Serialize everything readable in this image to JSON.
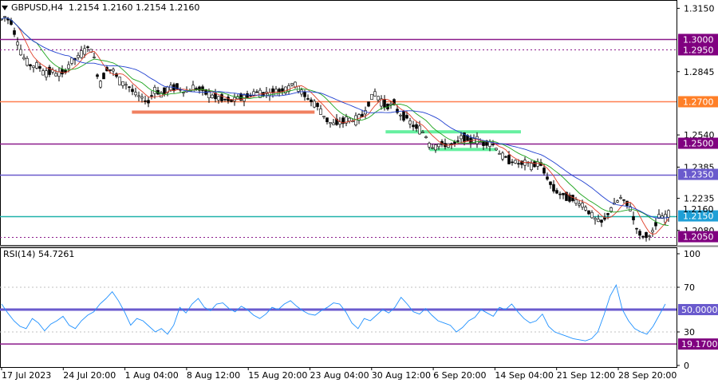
{
  "header": {
    "symbol_label": "GBPUSD,H4",
    "ohlc": "1.2154 1.2160 1.2154 1.2160"
  },
  "rsi_panel": {
    "label": "RSI(14) 54.7261"
  },
  "colors": {
    "candles": "#000000",
    "ma_fast": "#e0402a",
    "ma_mid": "#1fa51f",
    "ma_slow": "#2040d0",
    "rsi_line": "#1e90ff",
    "purple_level": "#8b1a8b",
    "orange_level": "#ff7f50",
    "cyan_level": "#20b2aa",
    "blue_level": "#6a5acd",
    "support_zone": "#f08060",
    "green_zone": "#66f0a0"
  },
  "chart_data": [
    {
      "type": "candlestick",
      "title": "GBPUSD,H4",
      "y_ticks": [
        "1.3150",
        "1.2845",
        "1.2540",
        "1.2385",
        "1.2235",
        "1.2080"
      ],
      "ylim": [
        1.201,
        1.319
      ],
      "x_ticks": [
        "17 Jul 2023",
        "24 Jul 20:00",
        "1 Aug 04:00",
        "8 Aug 12:00",
        "15 Aug 20:00",
        "23 Aug 04:00",
        "30 Aug 12:00",
        "6 Sep 20:00",
        "14 Sep 04:00",
        "21 Sep 12:00",
        "28 Sep 20:00"
      ],
      "price_path": [
        [
          0,
          1.309
        ],
        [
          6,
          1.311
        ],
        [
          14,
          1.3085
        ],
        [
          20,
          1.301
        ],
        [
          28,
          1.292
        ],
        [
          34,
          1.289
        ],
        [
          40,
          1.287
        ],
        [
          48,
          1.2875
        ],
        [
          56,
          1.2835
        ],
        [
          64,
          1.285
        ],
        [
          72,
          1.283
        ],
        [
          80,
          1.284
        ],
        [
          90,
          1.2895
        ],
        [
          100,
          1.292
        ],
        [
          108,
          1.296
        ],
        [
          116,
          1.295
        ],
        [
          122,
          1.283
        ],
        [
          126,
          1.279
        ],
        [
          134,
          1.286
        ],
        [
          142,
          1.285
        ],
        [
          150,
          1.28
        ],
        [
          160,
          1.278
        ],
        [
          170,
          1.2735
        ],
        [
          178,
          1.2715
        ],
        [
          186,
          1.27
        ],
        [
          194,
          1.276
        ],
        [
          202,
          1.2735
        ],
        [
          212,
          1.2765
        ],
        [
          222,
          1.277
        ],
        [
          232,
          1.2745
        ],
        [
          242,
          1.2765
        ],
        [
          252,
          1.276
        ],
        [
          262,
          1.2735
        ],
        [
          272,
          1.272
        ],
        [
          282,
          1.271
        ],
        [
          292,
          1.2705
        ],
        [
          300,
          1.272
        ],
        [
          310,
          1.2725
        ],
        [
          320,
          1.2745
        ],
        [
          330,
          1.274
        ],
        [
          340,
          1.2745
        ],
        [
          350,
          1.2755
        ],
        [
          360,
          1.2765
        ],
        [
          370,
          1.279
        ],
        [
          378,
          1.2745
        ],
        [
          388,
          1.271
        ],
        [
          398,
          1.268
        ],
        [
          408,
          1.262
        ],
        [
          416,
          1.259
        ],
        [
          426,
          1.26
        ],
        [
          436,
          1.2615
        ],
        [
          446,
          1.261
        ],
        [
          456,
          1.264
        ],
        [
          464,
          1.271
        ],
        [
          470,
          1.274
        ],
        [
          478,
          1.27
        ],
        [
          486,
          1.268
        ],
        [
          494,
          1.269
        ],
        [
          500,
          1.264
        ],
        [
          508,
          1.263
        ],
        [
          516,
          1.259
        ],
        [
          524,
          1.257
        ],
        [
          532,
          1.255
        ],
        [
          540,
          1.248
        ],
        [
          548,
          1.249
        ],
        [
          556,
          1.2495
        ],
        [
          564,
          1.249
        ],
        [
          572,
          1.25
        ],
        [
          580,
          1.2535
        ],
        [
          588,
          1.251
        ],
        [
          596,
          1.252
        ],
        [
          604,
          1.25
        ],
        [
          612,
          1.2505
        ],
        [
          620,
          1.249
        ],
        [
          628,
          1.244
        ],
        [
          636,
          1.2425
        ],
        [
          644,
          1.241
        ],
        [
          652,
          1.24
        ],
        [
          660,
          1.2405
        ],
        [
          668,
          1.239
        ],
        [
          676,
          1.241
        ],
        [
          684,
          1.235
        ],
        [
          692,
          1.229
        ],
        [
          700,
          1.226
        ],
        [
          708,
          1.2245
        ],
        [
          716,
          1.2235
        ],
        [
          724,
          1.2215
        ],
        [
          732,
          1.22
        ],
        [
          740,
          1.216
        ],
        [
          748,
          1.2125
        ],
        [
          756,
          1.212
        ],
        [
          764,
          1.2175
        ],
        [
          770,
          1.2205
        ],
        [
          778,
          1.2235
        ],
        [
          784,
          1.2215
        ],
        [
          790,
          1.219
        ],
        [
          796,
          1.211
        ],
        [
          802,
          1.206
        ],
        [
          808,
          1.205
        ],
        [
          814,
          1.206
        ],
        [
          820,
          1.208
        ],
        [
          826,
          1.215
        ],
        [
          832,
          1.2135
        ],
        [
          838,
          1.2158
        ],
        [
          842,
          1.216
        ]
      ],
      "levels": [
        {
          "label": "1.3000",
          "value": 1.3,
          "style": "solid",
          "color": "#8b1a8b",
          "badge": "#800080"
        },
        {
          "label": "1.2950",
          "value": 1.295,
          "style": "dotted",
          "color": "#8b1a8b",
          "badge": "#800080"
        },
        {
          "label": "1.2700",
          "value": 1.27,
          "style": "solid",
          "color": "#ff7f50",
          "badge": "#ff7f27"
        },
        {
          "label": "1.2500",
          "value": 1.25,
          "style": "solid",
          "color": "#8b1a8b",
          "badge": "#800080"
        },
        {
          "label": "1.2350",
          "value": 1.235,
          "style": "solid",
          "color": "#6a5acd",
          "badge": "#6a5acd"
        },
        {
          "label": "1.2150",
          "value": 1.215,
          "style": "solid",
          "color": "#20b2aa",
          "badge": "#1e9fd6"
        },
        {
          "label": "1.2050",
          "value": 1.205,
          "style": "dotted",
          "color": "#8b1a8b",
          "badge": "#800080"
        }
      ],
      "current_price_label": "1.2160",
      "zones": [
        {
          "name": "orange-support",
          "value": 1.265,
          "x_from": 0.195,
          "x_to": 0.465,
          "color": "#f08060"
        },
        {
          "name": "green-zone-upper",
          "value": 1.2555,
          "x_from": 0.57,
          "x_to": 0.77,
          "color": "#66f0a0"
        },
        {
          "name": "green-zone-lower",
          "value": 1.247,
          "x_from": 0.635,
          "x_to": 0.735,
          "color": "#66f0a0"
        }
      ]
    },
    {
      "type": "line",
      "title": "RSI(14) 54.7261",
      "y_ticks": [
        "100",
        "70",
        "30",
        "0"
      ],
      "ylim": [
        0,
        100
      ],
      "levels": [
        {
          "label": "50.0000",
          "value": 50,
          "color": "#6a5acd",
          "badge": "#6a5acd"
        },
        {
          "label": "19.1700",
          "value": 19.17,
          "color": "#8b1a8b",
          "badge": "#800080"
        }
      ],
      "rsi_values": [
        55,
        47,
        40,
        35,
        33,
        42,
        38,
        31,
        37,
        40,
        44,
        36,
        33,
        40,
        45,
        48,
        55,
        60,
        66,
        58,
        48,
        36,
        42,
        40,
        35,
        30,
        33,
        28,
        36,
        52,
        47,
        55,
        60,
        52,
        49,
        55,
        56,
        51,
        48,
        53,
        50,
        45,
        42,
        46,
        52,
        50,
        55,
        58,
        53,
        49,
        46,
        45,
        49,
        52,
        56,
        55,
        48,
        38,
        33,
        42,
        40,
        45,
        50,
        47,
        52,
        61,
        55,
        48,
        46,
        51,
        45,
        40,
        38,
        36,
        30,
        34,
        40,
        43,
        50,
        47,
        44,
        52,
        50,
        55,
        48,
        42,
        38,
        40,
        46,
        35,
        30,
        28,
        26,
        24,
        23,
        22,
        24,
        30,
        45,
        62,
        72,
        50,
        40,
        33,
        30,
        28,
        35,
        45,
        55
      ]
    }
  ]
}
